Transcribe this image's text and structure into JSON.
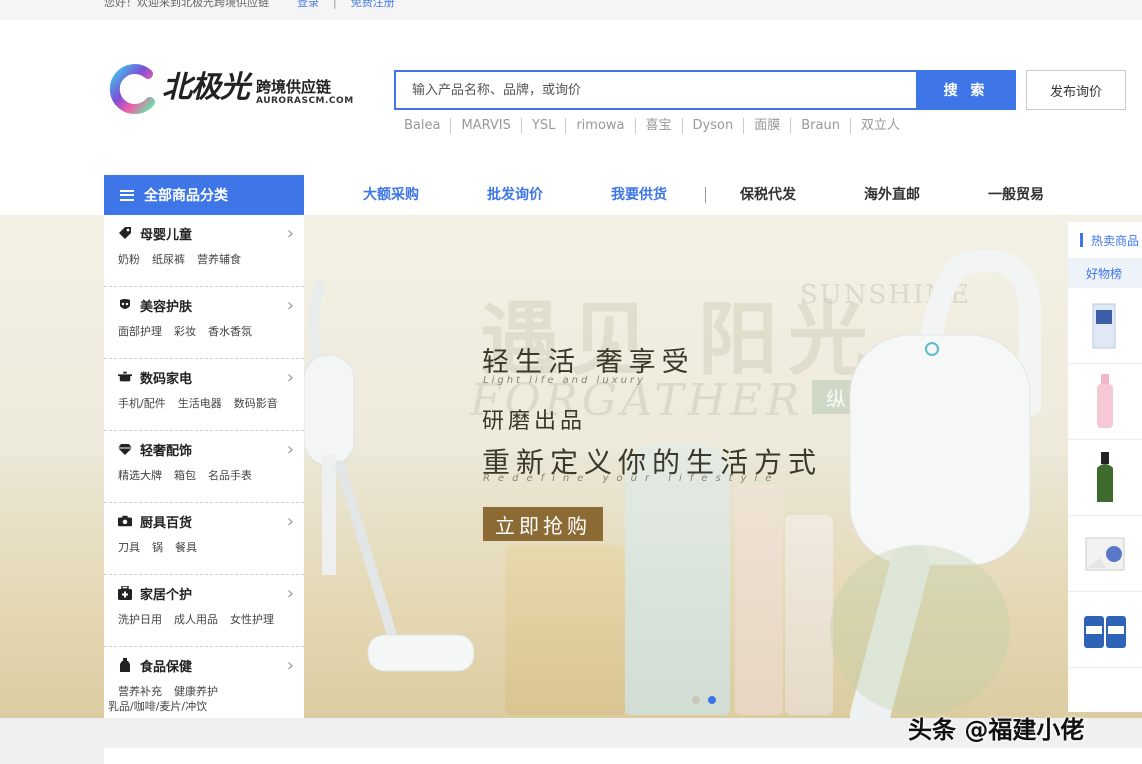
{
  "topbar": {
    "welcome": "您好！欢迎来到北极光跨境供应链",
    "login": "登录",
    "separator": "|",
    "register": "免费注册"
  },
  "logo": {
    "name": "北极光",
    "subtitle": "跨境供应链",
    "domain": "AURORASCM.COM",
    "colors": [
      "#3fc7e8",
      "#7b4fd8",
      "#f05fa8",
      "#6be0a8"
    ]
  },
  "search": {
    "placeholder": "输入产品名称、品牌，或询价",
    "button": "搜 索",
    "inquiry_button": "发布询价",
    "hotwords": [
      "Balea",
      "MARVIS",
      "YSL",
      "rimowa",
      "喜宝",
      "Dyson",
      "面膜",
      "Braun",
      "双立人"
    ]
  },
  "nav": {
    "all_categories": "全部商品分类",
    "items": [
      {
        "label": "大额采购",
        "color": "blue"
      },
      {
        "label": "批发询价",
        "color": "blue"
      },
      {
        "label": "我要供货",
        "color": "blue"
      },
      {
        "label": "保税代发",
        "color": "dark"
      },
      {
        "label": "海外直邮",
        "color": "dark"
      },
      {
        "label": "一般贸易",
        "color": "dark"
      }
    ]
  },
  "categories": [
    {
      "title": "母婴儿童",
      "icon": "tag-icon",
      "subs": [
        "奶粉",
        "纸尿裤",
        "营养辅食"
      ]
    },
    {
      "title": "美容护肤",
      "icon": "mask-icon",
      "subs": [
        "面部护理",
        "彩妆",
        "香水香氛"
      ]
    },
    {
      "title": "数码家电",
      "icon": "pot-icon",
      "subs": [
        "手机/配件",
        "生活电器",
        "数码影音"
      ]
    },
    {
      "title": "轻奢配饰",
      "icon": "diamond-icon",
      "subs": [
        "精选大牌",
        "箱包",
        "名品手表"
      ]
    },
    {
      "title": "厨具百货",
      "icon": "camera-icon",
      "subs": [
        "刀具",
        "锅",
        "餐具"
      ]
    },
    {
      "title": "家居个护",
      "icon": "medkit-icon",
      "subs": [
        "洗护日用",
        "成人用品",
        "女性护理"
      ]
    },
    {
      "title": "食品保健",
      "icon": "bottle-icon",
      "subs": [
        "营养补充",
        "健康养护",
        "乳品/咖啡/麦片/冲饮"
      ]
    }
  ],
  "banner": {
    "headline": "轻生活 奢享受",
    "headline_en": "Light life and luxury",
    "line2": "研磨出品",
    "line3": "重新定义你的生活方式",
    "line3_en": "Redefine your lifestyle",
    "cta": "立即抢购",
    "bg_text": "遇见 阳光",
    "bg_text_en": "FORGATHER",
    "bg_sunshine": "SUNSHINE",
    "bg_tag": "纵享自然",
    "slide_count": 2,
    "active_slide": 2
  },
  "right_panel": {
    "header": "热卖商品",
    "tab": "好物榜",
    "items": [
      "product-1",
      "product-2",
      "product-3",
      "product-4",
      "product-5"
    ]
  },
  "watermark": "头条 @福建小佬",
  "colors": {
    "accent": "#3e76e8",
    "cta": "#8b6a34"
  }
}
